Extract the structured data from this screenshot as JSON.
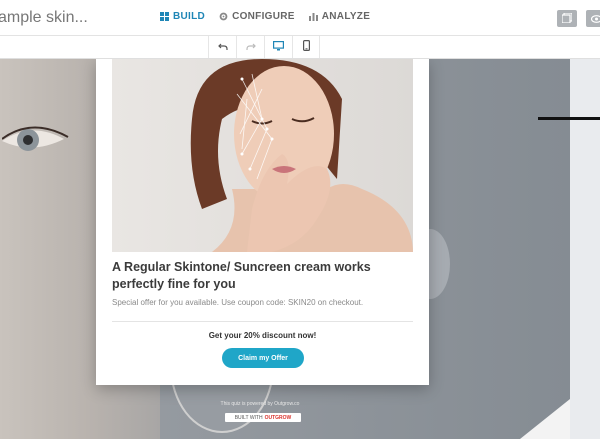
{
  "topbar": {
    "title": "ample skin...",
    "nav": [
      {
        "label": "BUILD",
        "icon": "build-icon",
        "active": true
      },
      {
        "label": "CONFIGURE",
        "icon": "gear-icon",
        "active": false
      },
      {
        "label": "ANALYZE",
        "icon": "bar-chart-icon",
        "active": false
      }
    ]
  },
  "toolbar": {
    "tools": [
      "undo-icon",
      "redo-icon",
      "desktop-icon",
      "mobile-icon"
    ]
  },
  "card": {
    "heading": "A Regular Skintone/ Suncreen cream works perfectly fine for you",
    "offer_text": "Special offer for you available. Use coupon code: SKIN20 on checkout.",
    "cta_heading": "Get your 20% discount now!",
    "cta_button": "Claim my Offer"
  },
  "footer": {
    "powered_text": "This quiz is powered by Outgrow.co",
    "built_with": "BUILT WITH",
    "brand": "OUTGROW"
  },
  "colors": {
    "accent": "#1f86b6",
    "cta": "#1fa6c8"
  }
}
